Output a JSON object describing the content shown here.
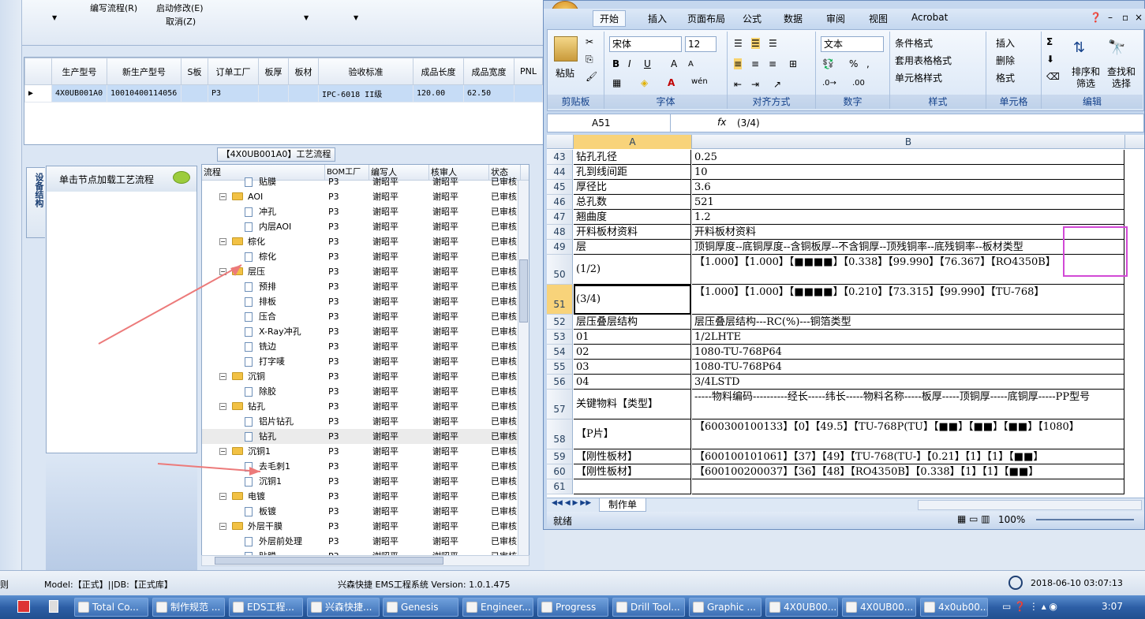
{
  "left_toolbar": {
    "item1": "编写流程(R)",
    "item2": "启动修改(E)",
    "item3": "取消(Z)"
  },
  "top_grid": {
    "columns": [
      "生产型号",
      "新生产型号",
      "S板",
      "订单工厂",
      "板厚",
      "板材",
      "验收标准",
      "成品长度",
      "成品宽度",
      "PNL"
    ],
    "row": [
      "4X0UB001A0",
      "10010400114056",
      "",
      "P3",
      "",
      "",
      "IPC-6018 II级",
      "120.00",
      "62.50",
      ""
    ]
  },
  "process_title": "【4X0UB001A0】工艺流程",
  "side_tab": "设备结构",
  "node_hint": "单击节点加载工艺流程",
  "tree": {
    "columns": [
      "流程",
      "BOM工厂",
      "编写人",
      "核审人",
      "状态"
    ],
    "rows": [
      {
        "indent": 2,
        "kind": "doc",
        "name": "贴膜",
        "bom": "P3",
        "w": "谢昭平",
        "r": "谢昭平",
        "s": "已审核"
      },
      {
        "indent": 1,
        "kind": "folder",
        "name": "AOI",
        "bom": "P3",
        "w": "谢昭平",
        "r": "谢昭平",
        "s": "已审核"
      },
      {
        "indent": 2,
        "kind": "doc",
        "name": "冲孔",
        "bom": "P3",
        "w": "谢昭平",
        "r": "谢昭平",
        "s": "已审核"
      },
      {
        "indent": 2,
        "kind": "doc",
        "name": "内层AOI",
        "bom": "P3",
        "w": "谢昭平",
        "r": "谢昭平",
        "s": "已审核"
      },
      {
        "indent": 1,
        "kind": "folder",
        "name": "棕化",
        "bom": "P3",
        "w": "谢昭平",
        "r": "谢昭平",
        "s": "已审核"
      },
      {
        "indent": 2,
        "kind": "doc",
        "name": "棕化",
        "bom": "P3",
        "w": "谢昭平",
        "r": "谢昭平",
        "s": "已审核"
      },
      {
        "indent": 1,
        "kind": "folder",
        "name": "层压",
        "bom": "P3",
        "w": "谢昭平",
        "r": "谢昭平",
        "s": "已审核"
      },
      {
        "indent": 2,
        "kind": "doc",
        "name": "预排",
        "bom": "P3",
        "w": "谢昭平",
        "r": "谢昭平",
        "s": "已审核"
      },
      {
        "indent": 2,
        "kind": "doc",
        "name": "排板",
        "bom": "P3",
        "w": "谢昭平",
        "r": "谢昭平",
        "s": "已审核"
      },
      {
        "indent": 2,
        "kind": "doc",
        "name": "压合",
        "bom": "P3",
        "w": "谢昭平",
        "r": "谢昭平",
        "s": "已审核"
      },
      {
        "indent": 2,
        "kind": "doc",
        "name": "X-Ray冲孔",
        "bom": "P3",
        "w": "谢昭平",
        "r": "谢昭平",
        "s": "已审核"
      },
      {
        "indent": 2,
        "kind": "doc",
        "name": "铣边",
        "bom": "P3",
        "w": "谢昭平",
        "r": "谢昭平",
        "s": "已审核"
      },
      {
        "indent": 2,
        "kind": "doc",
        "name": "打字唛",
        "bom": "P3",
        "w": "谢昭平",
        "r": "谢昭平",
        "s": "已审核"
      },
      {
        "indent": 1,
        "kind": "folder",
        "name": "沉铜",
        "bom": "P3",
        "w": "谢昭平",
        "r": "谢昭平",
        "s": "已审核"
      },
      {
        "indent": 2,
        "kind": "doc",
        "name": "除胶",
        "bom": "P3",
        "w": "谢昭平",
        "r": "谢昭平",
        "s": "已审核"
      },
      {
        "indent": 1,
        "kind": "folder",
        "name": "钻孔",
        "bom": "P3",
        "w": "谢昭平",
        "r": "谢昭平",
        "s": "已审核"
      },
      {
        "indent": 2,
        "kind": "doc",
        "name": "铝片钻孔",
        "bom": "P3",
        "w": "谢昭平",
        "r": "谢昭平",
        "s": "已审核"
      },
      {
        "indent": 2,
        "kind": "doc",
        "name": "钻孔",
        "bom": "P3",
        "w": "谢昭平",
        "r": "谢昭平",
        "s": "已审核"
      },
      {
        "indent": 1,
        "kind": "folder",
        "name": "沉铜1",
        "bom": "P3",
        "w": "谢昭平",
        "r": "谢昭平",
        "s": "已审核"
      },
      {
        "indent": 2,
        "kind": "doc",
        "name": "去毛刺1",
        "bom": "P3",
        "w": "谢昭平",
        "r": "谢昭平",
        "s": "已审核"
      },
      {
        "indent": 2,
        "kind": "doc",
        "name": "沉铜1",
        "bom": "P3",
        "w": "谢昭平",
        "r": "谢昭平",
        "s": "已审核"
      },
      {
        "indent": 1,
        "kind": "folder",
        "name": "电镀",
        "bom": "P3",
        "w": "谢昭平",
        "r": "谢昭平",
        "s": "已审核"
      },
      {
        "indent": 2,
        "kind": "doc",
        "name": "板镀",
        "bom": "P3",
        "w": "谢昭平",
        "r": "谢昭平",
        "s": "已审核"
      },
      {
        "indent": 1,
        "kind": "folder",
        "name": "外层干膜",
        "bom": "P3",
        "w": "谢昭平",
        "r": "谢昭平",
        "s": "已审核"
      },
      {
        "indent": 2,
        "kind": "doc",
        "name": "外层前处理",
        "bom": "P3",
        "w": "谢昭平",
        "r": "谢昭平",
        "s": "已审核"
      },
      {
        "indent": 2,
        "kind": "doc",
        "name": "贴膜",
        "bom": "P3",
        "w": "谢昭平",
        "r": "谢昭平",
        "s": "已审核"
      }
    ]
  },
  "status": {
    "left": "则",
    "model": "Model:【正式】||DB:【正式库】",
    "app": "兴森快捷 EMS工程系统 Version: 1.0.1.475",
    "datetime": "2018-06-10 03:07:13"
  },
  "excel": {
    "tabs": [
      "开始",
      "插入",
      "页面布局",
      "公式",
      "数据",
      "审阅",
      "视图",
      "Acrobat"
    ],
    "font": "宋体",
    "size": "12",
    "numfmt": "文本",
    "groups": [
      "剪贴板",
      "字体",
      "对齐方式",
      "数字",
      "样式",
      "单元格",
      "编辑"
    ],
    "buttons": {
      "paste": "粘贴",
      "cond": "条件格式",
      "tablefmt": "套用表格格式",
      "cellstyle": "单元格样式",
      "insert": "插入",
      "delete": "删除",
      "format": "格式",
      "sort": "排序和筛选",
      "find": "查找和选择"
    },
    "namebox": "A51",
    "formula": "(3/4)",
    "fx": "fx",
    "cols": [
      "A",
      "B"
    ],
    "rows": [
      {
        "n": "43",
        "a": "钻孔孔径",
        "b": "0.25",
        "h": 19
      },
      {
        "n": "44",
        "a": "孔到线间距",
        "b": "10",
        "h": 19
      },
      {
        "n": "45",
        "a": "厚径比",
        "b": "3.6",
        "h": 19
      },
      {
        "n": "46",
        "a": "总孔数",
        "b": "521",
        "h": 19
      },
      {
        "n": "47",
        "a": "翘曲度",
        "b": "1.2",
        "h": 19
      },
      {
        "n": "48",
        "a": "开料板材资料",
        "b": "开料板材资料",
        "h": 19
      },
      {
        "n": "49",
        "a": "层",
        "b": "顶铜厚度--底铜厚度--含铜板厚--不含铜厚--顶残铜率--底残铜率--板材类型",
        "h": 19
      },
      {
        "n": "50",
        "a": "(1/2)",
        "b": "【1.000】【1.000】【■■■■】【0.338】【99.990】【76.367】【RO4350B】",
        "h": 38
      },
      {
        "n": "51",
        "a": "(3/4)",
        "b": "【1.000】【1.000】【■■■■】【0.210】【73.315】【99.990】【TU-768】",
        "h": 38
      },
      {
        "n": "52",
        "a": "层压叠层结构",
        "b": "层压叠层结构---RC(%)---铜箔类型",
        "h": 19
      },
      {
        "n": "53",
        "a": "01",
        "b": "1/2LHTE",
        "h": 19
      },
      {
        "n": "54",
        "a": "02",
        "b": "1080-TU-768P64",
        "h": 19
      },
      {
        "n": "55",
        "a": "03",
        "b": "1080-TU-768P64",
        "h": 19
      },
      {
        "n": "56",
        "a": "04",
        "b": "3/4LSTD",
        "h": 19
      },
      {
        "n": "57",
        "a": "关键物料【类型】",
        "b": "-----物料编码----------经长-----纬长-----物料名称-----板厚-----顶铜厚-----底铜厚-----PP型号",
        "h": 38
      },
      {
        "n": "58",
        "a": "【P片】",
        "b": "【600300100133】【0】【49.5】【TU-768P(TU】【■■】【■■】【■■】【1080】",
        "h": 38
      },
      {
        "n": "59",
        "a": "【刚性板材】",
        "b": "【600100101061】【37】【49】【TU-768(TU-】【0.21】【1】【1】【■■】",
        "h": 19
      },
      {
        "n": "60",
        "a": "【刚性板材】",
        "b": "【600100200037】【36】【48】【RO4350B】【0.338】【1】【1】【■■】",
        "h": 19
      },
      {
        "n": "61",
        "a": "",
        "b": "",
        "h": 19
      }
    ],
    "sheet_tab": "制作单",
    "ready": "就绪",
    "zoom": "100%"
  },
  "taskbar": [
    "Total Co...",
    "制作规范 ...",
    "EDS工程...",
    "兴森快捷...",
    "Genesis",
    "Engineer...",
    "Progress",
    "Drill Tool...",
    "Graphic ...",
    "4X0UB00...",
    "4X0UB00...",
    "4x0ub00..."
  ],
  "clock": "3:07",
  "accent": "#d24ad6"
}
